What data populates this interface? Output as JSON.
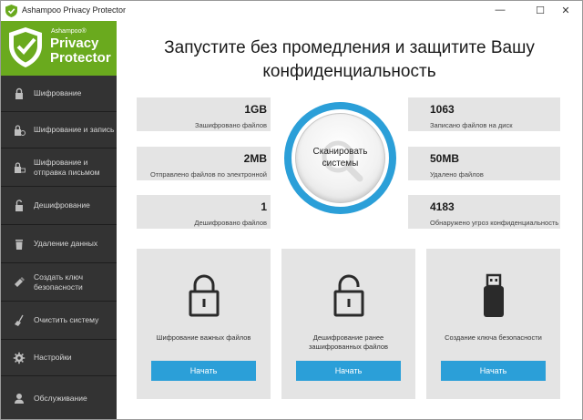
{
  "window": {
    "title": "Ashampoo Privacy Protector",
    "minimize_glyph": "—",
    "maximize_glyph": "☐",
    "close_glyph": "✕"
  },
  "logo": {
    "small": "Ashampoo®",
    "line1": "Privacy",
    "line2": "Protector"
  },
  "sidebar": {
    "items": [
      {
        "label": "Шифрование",
        "icon": "lock-icon"
      },
      {
        "label": "Шифрование и запись",
        "icon": "lock-disc-icon"
      },
      {
        "label": "Шифрование и отправка письмом",
        "icon": "lock-mail-icon"
      },
      {
        "label": "Дешифрование",
        "icon": "unlock-icon"
      },
      {
        "label": "Удаление данных",
        "icon": "trash-icon"
      },
      {
        "label": "Создать ключ безопасности",
        "icon": "usb-key-icon"
      },
      {
        "label": "Очистить систему",
        "icon": "broom-icon"
      },
      {
        "label": "Настройки",
        "icon": "gear-icon"
      },
      {
        "label": "Обслуживание",
        "icon": "support-icon"
      }
    ]
  },
  "main": {
    "headline_line1": "Запустите без промедления и защитите Вашу",
    "headline_line2": "конфиденциальность",
    "stats": [
      {
        "value": "1GB",
        "label": "Зашифровано файлов"
      },
      {
        "value": "1063",
        "label": "Записано файлов на диск"
      },
      {
        "value": "2MB",
        "label": "Отправлено файлов по электронной"
      },
      {
        "value": "50MB",
        "label": "Удалено файлов"
      },
      {
        "value": "1",
        "label": "Дешифровано файлов"
      },
      {
        "value": "4183",
        "label": "Обнаружено угроз конфиденциальность"
      }
    ],
    "scan_button": {
      "line1": "Сканировать",
      "line2": "системы"
    },
    "cards": [
      {
        "text_line1": "Шифрование важных файлов",
        "text_line2": "",
        "button": "Начать",
        "icon": "padlock-closed-icon"
      },
      {
        "text_line1": "Дешифрование ранее",
        "text_line2": "зашифрованных файлов",
        "button": "Начать",
        "icon": "padlock-open-icon"
      },
      {
        "text_line1": "Создание ключа безопасности",
        "text_line2": "",
        "button": "Начать",
        "icon": "usb-stick-icon"
      }
    ]
  },
  "colors": {
    "accent": "#2b9fd8",
    "brand_green": "#6aaa1e",
    "sidebar_bg": "#333333",
    "panel_bg": "#e4e4e4"
  }
}
